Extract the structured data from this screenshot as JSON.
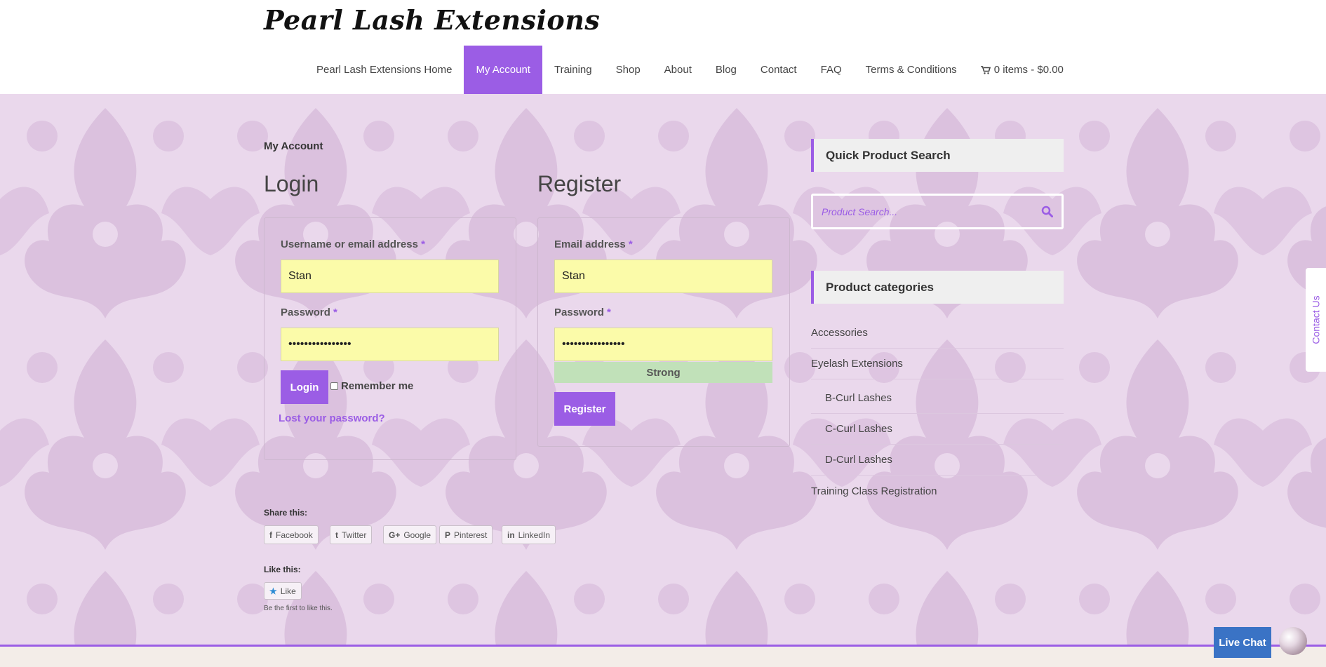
{
  "site": {
    "logo": "Pearl Lash Extensions"
  },
  "nav": {
    "items": [
      {
        "label": "Pearl Lash Extensions Home",
        "active": false
      },
      {
        "label": "My Account",
        "active": true
      },
      {
        "label": "Training",
        "active": false
      },
      {
        "label": "Shop",
        "active": false
      },
      {
        "label": "About",
        "active": false
      },
      {
        "label": "Blog",
        "active": false
      },
      {
        "label": "Contact",
        "active": false
      },
      {
        "label": "FAQ",
        "active": false
      },
      {
        "label": "Terms & Conditions",
        "active": false
      }
    ],
    "cart_label": "0 items - $0.00",
    "cart_icon": "cart-icon"
  },
  "breadcrumb": "My Account",
  "login": {
    "title": "Login",
    "username_label": "Username or email address",
    "username_value": "Stan",
    "password_label": "Password",
    "password_value": "••••••••••••••••",
    "required_mark": "*",
    "button_label": "Login",
    "remember_label": "Remember me",
    "lost_password": "Lost your password?"
  },
  "register": {
    "title": "Register",
    "email_label": "Email address",
    "email_value": "Stan",
    "password_label": "Password",
    "password_value": "••••••••••••••••",
    "required_mark": "*",
    "strength": "Strong",
    "button_label": "Register"
  },
  "share": {
    "title": "Share this:",
    "buttons": [
      {
        "label": "Facebook",
        "icon": "f"
      },
      {
        "label": "Twitter",
        "icon": "t"
      },
      {
        "label": "Google",
        "icon": "G+"
      },
      {
        "label": "Pinterest",
        "icon": "P"
      },
      {
        "label": "LinkedIn",
        "icon": "in"
      }
    ]
  },
  "like": {
    "title": "Like this:",
    "button_label": "Like",
    "subtext": "Be the first to like this."
  },
  "sidebar": {
    "search_title": "Quick Product Search",
    "search_placeholder": "Product Search...",
    "categories_title": "Product categories",
    "categories": [
      {
        "label": "Accessories",
        "sub": false
      },
      {
        "label": "Eyelash Extensions",
        "sub": false
      },
      {
        "label": "B-Curl Lashes",
        "sub": true
      },
      {
        "label": "C-Curl Lashes",
        "sub": true
      },
      {
        "label": "D-Curl Lashes",
        "sub": true
      },
      {
        "label": "Training Class Registration",
        "sub": false
      }
    ]
  },
  "contact_tab": "Contact Us",
  "live_chat": "Live Chat",
  "colors": {
    "accent": "#9b5de5",
    "input_bg": "#fbfba9",
    "strength_bg": "#c1e1b9",
    "chat_blue": "#3a73c5"
  }
}
